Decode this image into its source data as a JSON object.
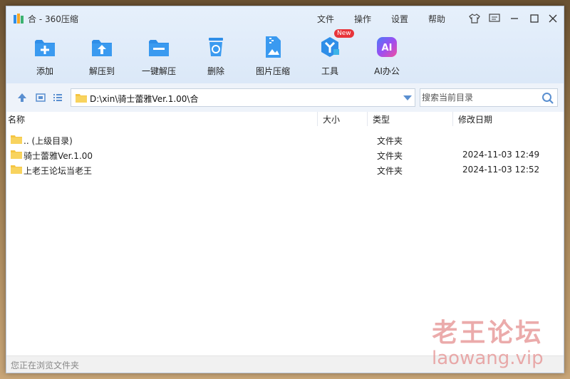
{
  "window": {
    "title": "合 - 360压缩",
    "menu": [
      "文件",
      "操作",
      "设置",
      "帮助"
    ]
  },
  "toolbar": {
    "items": [
      {
        "label": "添加",
        "icon": "add-archive-icon"
      },
      {
        "label": "解压到",
        "icon": "extract-to-icon"
      },
      {
        "label": "一键解压",
        "icon": "one-click-extract-icon"
      },
      {
        "label": "删除",
        "icon": "delete-icon"
      },
      {
        "label": "图片压缩",
        "icon": "image-compress-icon"
      },
      {
        "label": "工具",
        "icon": "tools-icon",
        "badge": "New"
      },
      {
        "label": "AI办公",
        "icon": "ai-office-icon",
        "icon_text": "AI"
      }
    ]
  },
  "address": {
    "path": "D:\\xin\\骑士蕾雅Ver.1.00\\合",
    "search_placeholder": "搜索当前目录"
  },
  "columns": {
    "name": "名称",
    "size": "大小",
    "type": "类型",
    "date": "修改日期"
  },
  "files": [
    {
      "name": ".. (上级目录)",
      "size": "",
      "type": "文件夹",
      "date": ""
    },
    {
      "name": "骑士蕾雅Ver.1.00",
      "size": "",
      "type": "文件夹",
      "date": "2024-11-03 12:49"
    },
    {
      "name": "上老王论坛当老王",
      "size": "",
      "type": "文件夹",
      "date": "2024-11-03 12:52"
    }
  ],
  "status": "您正在浏览文件夹",
  "watermark": {
    "text": "老王论坛",
    "url": "laowang.vip"
  },
  "colors": {
    "accent": "#2f8ee8",
    "folder": "#f5c542",
    "title_bg": "#e6f0fb"
  }
}
